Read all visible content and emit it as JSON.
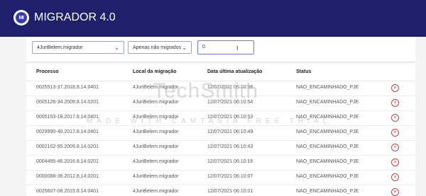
{
  "app": {
    "title": "MIGRADOR 4.0",
    "logo_text": "MI"
  },
  "filters": {
    "file_select": "4JuriBelem.migrador",
    "status_select": "Apenas não migrados",
    "search_value": "0"
  },
  "table": {
    "headers": [
      "Processo",
      "Local da migração",
      "Data última atualização",
      "Status"
    ],
    "rows": [
      [
        "0025513-37.2018.8.14.0401",
        "4JuriBelem.migrador",
        "12/07/2021 06:10:56",
        "NAO_ENCAMINHADO_PJE"
      ],
      [
        "0005126-34.2009.8.14.0201",
        "4JuriBelem.migrador",
        "12/07/2021 06:10:54",
        "NAO_ENCAMINHADO_PJE"
      ],
      [
        "0005153-18.2017.8.14.0401",
        "4JuriBelem.migrador",
        "12/07/2021 06:10:53",
        "NAO_ENCAMINHADO_PJE"
      ],
      [
        "0029990-40.2017.8.14.0401",
        "4JuriBelem.migrador",
        "12/07/2021 06:10:49",
        "NAO_ENCAMINHADO_PJE"
      ],
      [
        "0002102-95.2009.8.14.0201",
        "4JuriBelem.migrador",
        "12/07/2021 06:10:43",
        "NAO_ENCAMINHADO_PJE"
      ],
      [
        "0004495-46.2016.8.14.0201",
        "4JuriBelem.migrador",
        "12/07/2021 06:10:16",
        "NAO_ENCAMINHADO_PJE"
      ],
      [
        "0000088-36.2012.8.14.0201",
        "4JuriBelem.migrador",
        "12/07/2021 06:10:07",
        "NAO_ENCAMINHADO_PJE"
      ],
      [
        "0025607-08.2015.8.14.0401",
        "4JuriBelem.migrador",
        "12/07/2021 06:10:01",
        "NAO_ENCAMINHADO_PJE"
      ]
    ],
    "delete_icon": "close-circle-icon"
  },
  "watermark": {
    "brand": "TechSmith",
    "line": "MADE WITH CAMTASIA FREE TRIAL"
  },
  "colors": {
    "topbar": "#1f1f6b",
    "delete": "#d03a3a",
    "accent": "#2f3f8f"
  }
}
